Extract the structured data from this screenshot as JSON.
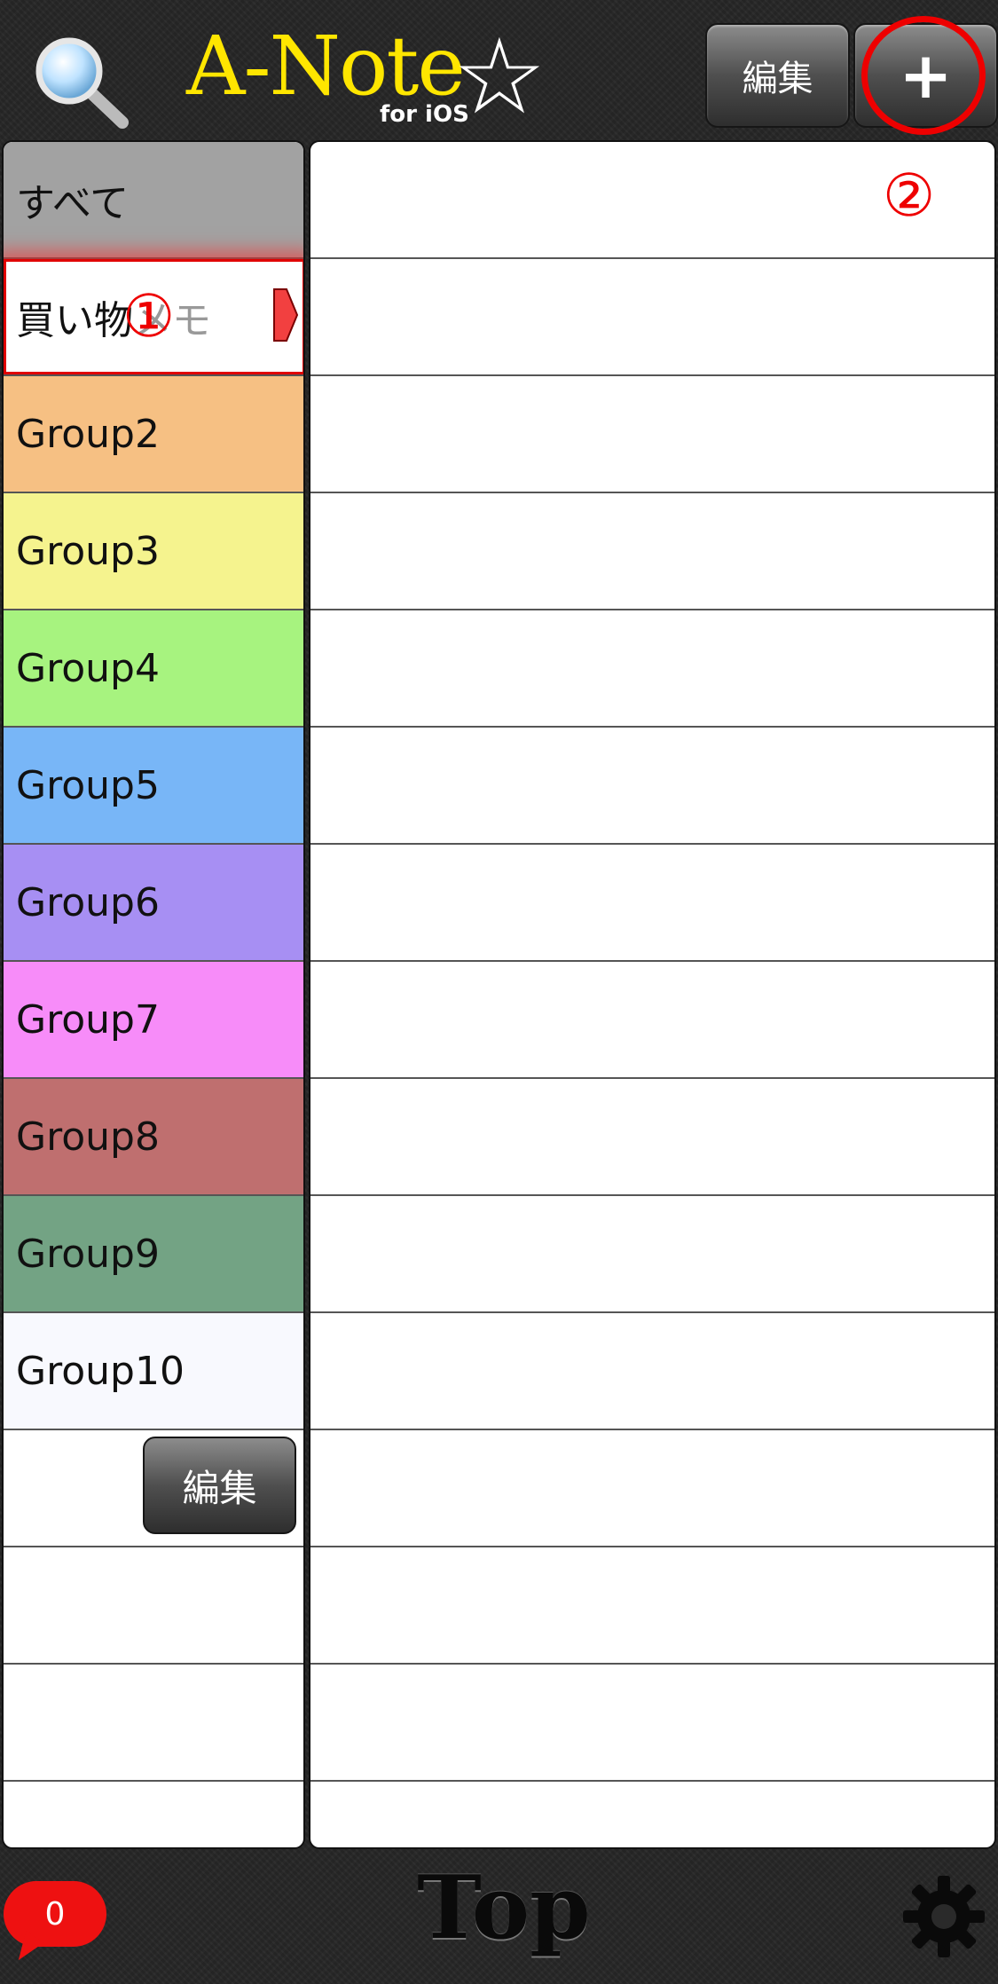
{
  "header": {
    "logo_main": "A-Note",
    "logo_sub": "for iOS",
    "logo_star": "☆",
    "edit_label": "編集",
    "add_label": "+"
  },
  "callouts": [
    "①",
    "②"
  ],
  "groups": [
    {
      "label": "すべて",
      "color": "#a2a2a2"
    },
    {
      "label_visible": "買い物",
      "label_faded": "メモ",
      "color": "#ffffff"
    },
    {
      "label": "Group2",
      "color": "#f6c083"
    },
    {
      "label": "Group3",
      "color": "#f5f38e"
    },
    {
      "label": "Group4",
      "color": "#a7f37f"
    },
    {
      "label": "Group5",
      "color": "#78b6f7"
    },
    {
      "label": "Group6",
      "color": "#a78ff3"
    },
    {
      "label": "Group7",
      "color": "#f78cf9"
    },
    {
      "label": "Group8",
      "color": "#bf6f6f"
    },
    {
      "label": "Group9",
      "color": "#73a384"
    },
    {
      "label": "Group10",
      "color": "#f8f9fe"
    }
  ],
  "left_edit_label": "編集",
  "footer": {
    "badge_count": "0",
    "title": "Top"
  },
  "icons": {
    "search": "search-icon",
    "gear": "gear-icon",
    "arrow": "red-arrow-icon"
  }
}
